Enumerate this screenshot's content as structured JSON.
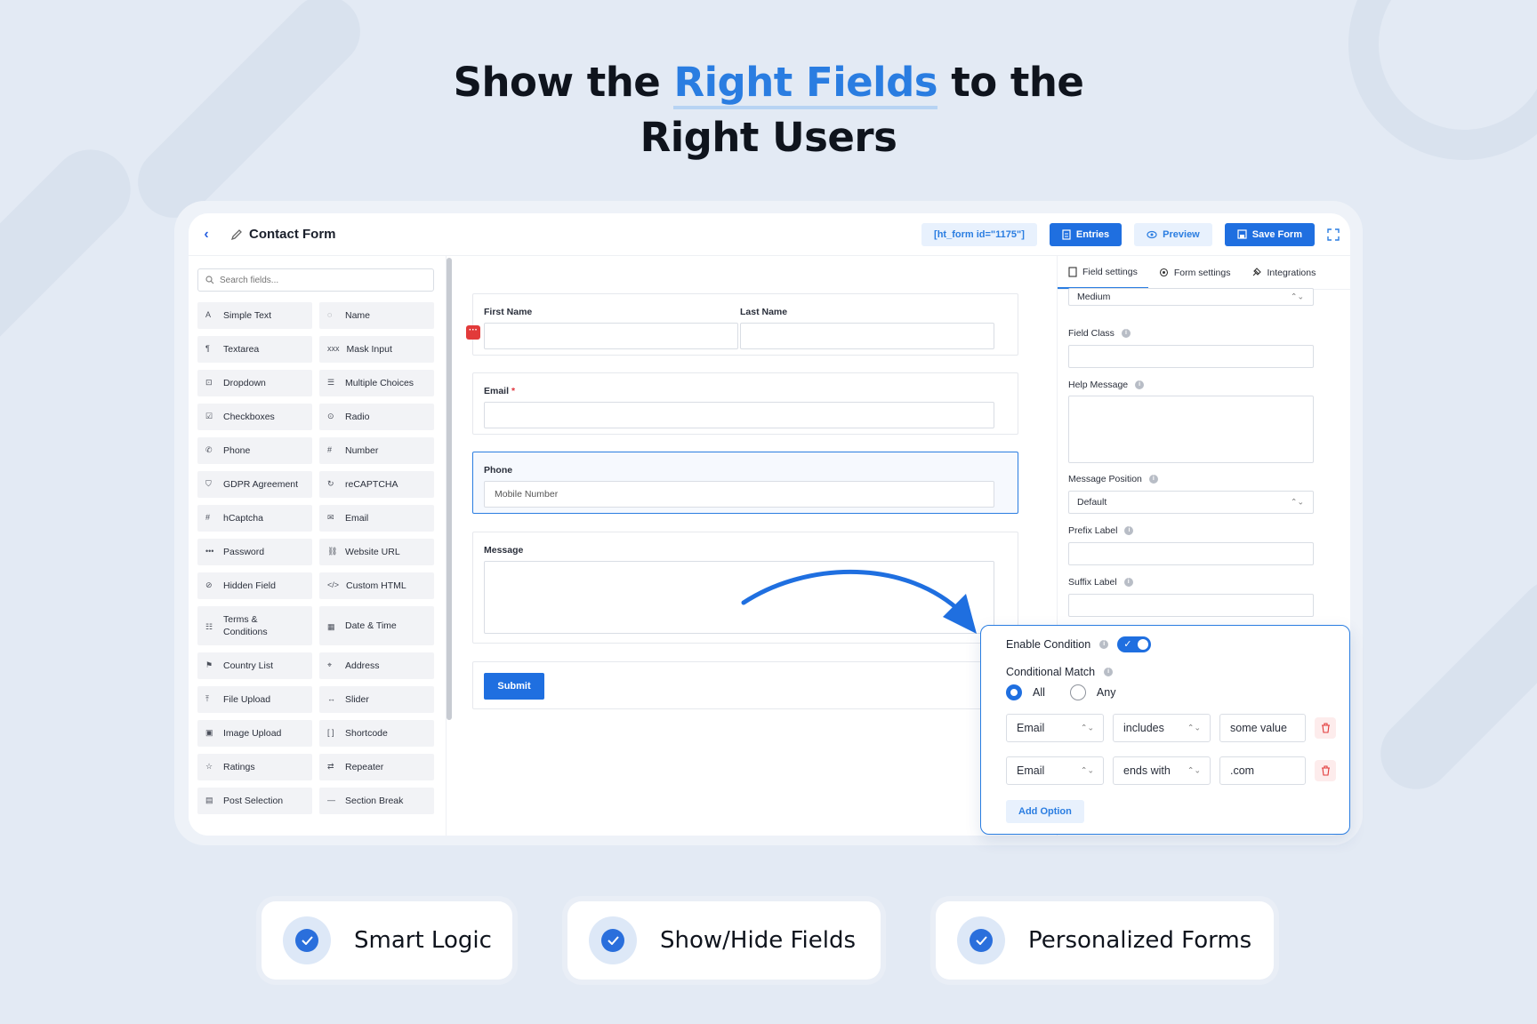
{
  "headline": {
    "before": "Show the ",
    "accent": "Right Fields",
    "after_line1": " to the",
    "line2": "Right Users"
  },
  "colors": {
    "accent": "#2a7de1",
    "primary_button": "#1f6fe0",
    "danger": "#e23a3a"
  },
  "topbar": {
    "title": "Contact Form",
    "shortcode": "[ht_form id=\"1175\"]",
    "entries_label": "Entries",
    "preview_label": "Preview",
    "save_label": "Save Form"
  },
  "fields_panel": {
    "search_placeholder": "Search fields...",
    "items": [
      {
        "label": "Simple Text",
        "icon": "text-icon"
      },
      {
        "label": "Name",
        "icon": "user-icon"
      },
      {
        "label": "Textarea",
        "icon": "paragraph-icon"
      },
      {
        "label": "Mask Input",
        "icon": "mask-icon"
      },
      {
        "label": "Dropdown",
        "icon": "dropdown-icon"
      },
      {
        "label": "Multiple Choices",
        "icon": "list-icon"
      },
      {
        "label": "Checkboxes",
        "icon": "checkbox-icon"
      },
      {
        "label": "Radio",
        "icon": "radio-icon"
      },
      {
        "label": "Phone",
        "icon": "phone-icon"
      },
      {
        "label": "Number",
        "icon": "hash-icon"
      },
      {
        "label": "GDPR Agreement",
        "icon": "shield-icon"
      },
      {
        "label": "reCAPTCHA",
        "icon": "refresh-icon"
      },
      {
        "label": "hCaptcha",
        "icon": "hash-icon"
      },
      {
        "label": "Email",
        "icon": "mail-icon"
      },
      {
        "label": "Password",
        "icon": "dots-icon"
      },
      {
        "label": "Website URL",
        "icon": "link-icon"
      },
      {
        "label": "Hidden Field",
        "icon": "eye-off-icon"
      },
      {
        "label": "Custom HTML",
        "icon": "html-icon"
      },
      {
        "label": "Terms & Conditions",
        "icon": "terms-icon"
      },
      {
        "label": "Date & Time",
        "icon": "calendar-icon"
      },
      {
        "label": "Country List",
        "icon": "flag-icon"
      },
      {
        "label": "Address",
        "icon": "map-icon"
      },
      {
        "label": "File Upload",
        "icon": "upload-icon"
      },
      {
        "label": "Slider",
        "icon": "slider-icon"
      },
      {
        "label": "Image Upload",
        "icon": "image-icon"
      },
      {
        "label": "Shortcode",
        "icon": "brackets-icon"
      },
      {
        "label": "Ratings",
        "icon": "star-icon"
      },
      {
        "label": "Repeater",
        "icon": "repeat-icon"
      },
      {
        "label": "Post Selection",
        "icon": "document-icon"
      },
      {
        "label": "Section Break",
        "icon": "section-icon"
      }
    ]
  },
  "form": {
    "first_name_label": "First Name",
    "last_name_label": "Last Name",
    "email_label": "Email",
    "required_mark": "*",
    "phone_label": "Phone",
    "phone_placeholder": "Mobile Number",
    "message_label": "Message",
    "submit_label": "Submit"
  },
  "settings_panel": {
    "tabs": [
      "Field settings",
      "Form settings",
      "Integrations"
    ],
    "size_value": "Medium",
    "field_class_label": "Field Class",
    "help_message_label": "Help Message",
    "message_position_label": "Message Position",
    "message_position_value": "Default",
    "prefix_label": "Prefix Label",
    "suffix_label": "Suffix Label"
  },
  "condition": {
    "enable_label": "Enable Condition",
    "enabled": true,
    "match_label": "Conditional Match",
    "options": [
      "All",
      "Any"
    ],
    "selected": "All",
    "rules": [
      {
        "field": "Email",
        "operator": "includes",
        "value": "some value"
      },
      {
        "field": "Email",
        "operator": "ends with",
        "value": ".com"
      }
    ],
    "add_option_label": "Add Option"
  },
  "features": [
    "Smart Logic",
    "Show/Hide Fields",
    "Personalized Forms"
  ]
}
